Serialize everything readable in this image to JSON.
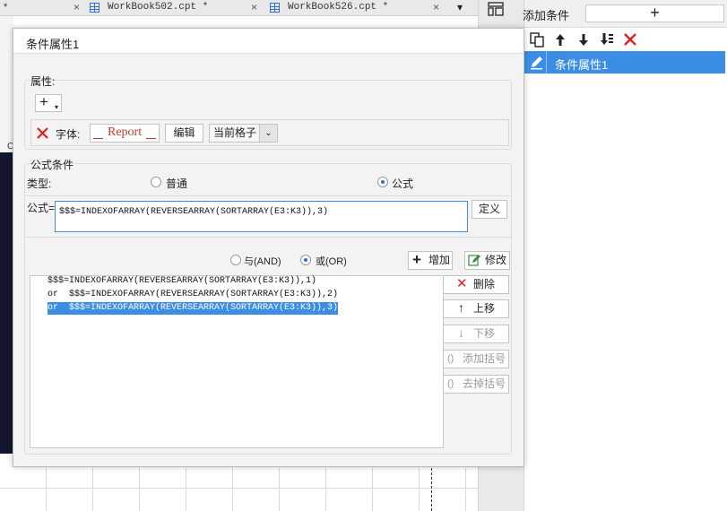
{
  "tabs": [
    {
      "label": "*",
      "close": "×"
    },
    {
      "label": "WorkBook502.cpt *",
      "close": "×"
    },
    {
      "label": "WorkBook526.cpt *",
      "close": "×"
    }
  ],
  "sheet": {
    "partial_text": "C"
  },
  "right_panel": {
    "title": "添加条件",
    "add_symbol": "+",
    "toolbar": [
      "copy-icon",
      "arrow-up-icon",
      "arrow-down-icon",
      "sort-down-icon",
      "delete-icon"
    ],
    "items": [
      {
        "label": "条件属性1",
        "selected": true
      }
    ]
  },
  "dialog": {
    "title": "条件属性1",
    "properties": {
      "label": "属性:",
      "add_symbol": "+",
      "font_label": "字体:",
      "font_preview": "Report",
      "edit_button": "编辑",
      "scope_select": "当前格子"
    },
    "formula": {
      "section_label": "公式条件",
      "type_label": "类型:",
      "type_options": [
        {
          "label": "普通",
          "selected": false
        },
        {
          "label": "公式",
          "selected": true
        }
      ],
      "formula_label": "公式=",
      "formula_value": "$$$=INDEXOFARRAY(REVERSEARRAY(SORTARRAY(E3:K3)),3)",
      "define_button": "定义",
      "logic_options": [
        {
          "label": "与(AND)",
          "selected": false
        },
        {
          "label": "或(OR)",
          "selected": true
        }
      ],
      "add_button": "增加",
      "modify_button": "修改",
      "conditions": [
        {
          "text": "$$$=INDEXOFARRAY(REVERSEARRAY(SORTARRAY(E3:K3)),1)",
          "selected": false
        },
        {
          "text": "or  $$$=INDEXOFARRAY(REVERSEARRAY(SORTARRAY(E3:K3)),2)",
          "selected": false
        },
        {
          "text": "or  $$$=INDEXOFARRAY(REVERSEARRAY(SORTARRAY(E3:K3)),3)",
          "selected": true
        }
      ],
      "buttons": {
        "delete": "删除",
        "move_up": "上移",
        "move_down": "下移",
        "add_bracket": "添加括号",
        "remove_bracket": "去掉括号"
      }
    }
  },
  "colors": {
    "accent": "#3c8ee5",
    "delete_red": "#e02020",
    "panel_bg": "#f3f3f3"
  }
}
